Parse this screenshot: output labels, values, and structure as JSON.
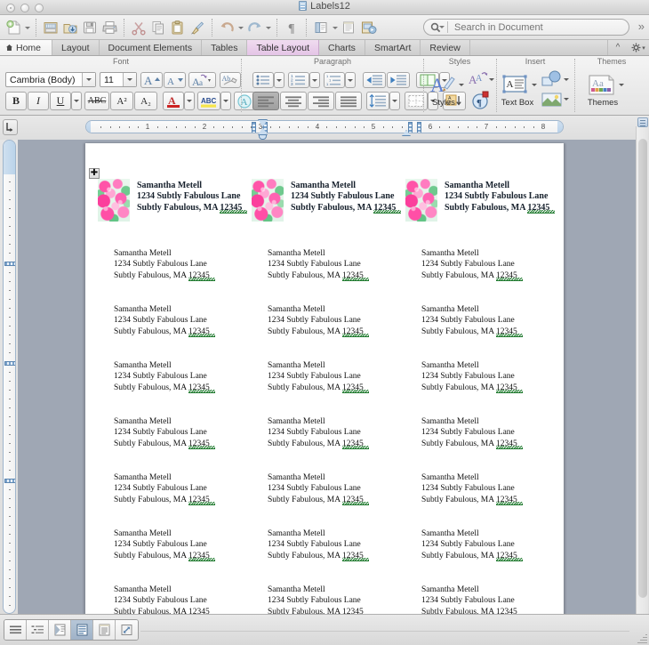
{
  "window": {
    "title": "Labels12",
    "doc_icon": "document-icon",
    "traffic_lights": [
      "close-button",
      "minimize-button",
      "zoom-button"
    ]
  },
  "toolbar": {
    "items": [
      {
        "name": "new-document-button",
        "icon": "new-document-icon",
        "caret": true
      },
      {
        "sep": true
      },
      {
        "name": "open-button",
        "icon": "open-folder-icon",
        "caret": false
      },
      {
        "name": "save-as-download-button",
        "icon": "download-arrow-icon",
        "caret": false
      },
      {
        "name": "save-button",
        "icon": "floppy-disk-icon",
        "caret": false
      },
      {
        "name": "print-button",
        "icon": "printer-icon",
        "caret": false
      },
      {
        "sep": true
      },
      {
        "name": "cut-button",
        "icon": "scissors-icon",
        "caret": false
      },
      {
        "name": "copy-button",
        "icon": "copy-pages-icon",
        "caret": false
      },
      {
        "name": "paste-button",
        "icon": "clipboard-icon",
        "caret": false
      },
      {
        "name": "format-painter-button",
        "icon": "paintbrush-icon",
        "caret": false
      },
      {
        "sep": true
      },
      {
        "name": "undo-button",
        "icon": "undo-arrow-icon",
        "caret": true
      },
      {
        "name": "redo-button",
        "icon": "redo-arrow-icon",
        "caret": true
      },
      {
        "sep": true
      },
      {
        "name": "show-formatting-marks-button",
        "icon": "pilcrow-icon",
        "caret": false
      },
      {
        "sep": true
      },
      {
        "name": "sidebar-toggle-button",
        "icon": "sidebar-panel-icon",
        "caret": true
      },
      {
        "name": "notebook-layout-button",
        "icon": "document-lines-icon",
        "caret": false
      },
      {
        "name": "media-browser-button",
        "icon": "media-browser-icon",
        "caret": false
      }
    ],
    "search": {
      "placeholder": "Search in Document",
      "value": "",
      "icon": "search-magnifier-icon"
    },
    "overflow_label": "»"
  },
  "ribbon_tabs": {
    "active": "Table Layout",
    "items": [
      {
        "label": "Home",
        "icon": "home-icon",
        "active": false,
        "home": true
      },
      {
        "label": "Layout",
        "active": false
      },
      {
        "label": "Document Elements",
        "active": false
      },
      {
        "label": "Tables",
        "active": false
      },
      {
        "label": "Table Layout",
        "active": true
      },
      {
        "label": "Charts",
        "active": false
      },
      {
        "label": "SmartArt",
        "active": false
      },
      {
        "label": "Review",
        "active": false
      }
    ],
    "collapse_icon": "chevron-up-icon",
    "settings_icon": "gear-icon"
  },
  "ribbon": {
    "groups": [
      {
        "label": "Font"
      },
      {
        "label": "Paragraph"
      },
      {
        "label": "Styles"
      },
      {
        "label": "Insert"
      },
      {
        "label": "Themes"
      }
    ],
    "font": {
      "font_name": "Cambria (Body)",
      "font_size": "11",
      "grow_font": "grow-font-icon",
      "shrink_font": "shrink-font-icon",
      "change_case": "change-case-icon",
      "clear_formatting": "clear-formatting-icon",
      "bold": "B",
      "italic": "I",
      "underline": "U",
      "strikethrough": "ABC",
      "superscript": "A²",
      "subscript": "A₂",
      "font_color": "font-color-icon",
      "highlight": "highlight-icon",
      "text_effects": "text-effects-icon"
    },
    "paragraph": {
      "bullets": "bulleted-list-icon",
      "numbering": "numbered-list-icon",
      "multilevel": "multilevel-list-icon",
      "decrease_indent": "decrease-indent-icon",
      "increase_indent": "increase-indent-icon",
      "columns": "columns-icon",
      "align_left": "align-left-icon",
      "align_center": "align-center-icon",
      "align_right": "align-right-icon",
      "justify": "justify-icon",
      "line_spacing": "line-spacing-icon",
      "borders": "borders-icon",
      "sort": "sort-az-icon"
    },
    "styles": {
      "styles_label": "Styles",
      "styles_icon": "styles-pen-icon",
      "quick_styles_icon": "quick-styles-icon",
      "toolbox_icon": "toolbox-icon"
    },
    "insert": {
      "text_box_label": "Text Box",
      "text_box_icon": "text-box-icon",
      "shapes_icon": "shapes-icon",
      "picture_icon": "picture-icon"
    },
    "themes": {
      "themes_label": "Themes",
      "themes_icon": "themes-icon"
    }
  },
  "ruler": {
    "tab_selector_icon": "tab-stop-selector-icon",
    "horizontal_numbers": [
      "1",
      "2",
      "3",
      "4",
      "5",
      "6",
      "7",
      "8"
    ],
    "unit": "inches"
  },
  "document": {
    "page_label": "label-sheet-page",
    "table_move_handle": "✚",
    "rows": [
      {
        "has_image": true,
        "cells": [
          {
            "image": "floral-roses-thumbnail",
            "lines": [
              "Samantha Metell",
              "1234 Subtly Fabulous Lane",
              "Subtly Fabulous, MA "
            ],
            "zip": "12345"
          },
          {
            "image": "floral-roses-thumbnail",
            "lines": [
              "Samantha Metell",
              "1234 Subtly Fabulous Lane",
              "Subtly Fabulous, MA "
            ],
            "zip": "12345"
          },
          {
            "image": "floral-roses-thumbnail",
            "lines": [
              "Samantha Metell",
              "1234 Subtly Fabulous Lane",
              "Subtly Fabulous, MA "
            ],
            "zip": "12345"
          }
        ]
      },
      {
        "has_image": false,
        "cells": [
          {
            "lines": [
              "Samantha Metell",
              "1234 Subtly Fabulous Lane",
              "Subtly Fabulous, MA "
            ],
            "zip": "12345"
          },
          {
            "lines": [
              "Samantha Metell",
              "1234 Subtly Fabulous Lane",
              "Subtly Fabulous, MA "
            ],
            "zip": "12345"
          },
          {
            "lines": [
              "Samantha Metell",
              "1234 Subtly Fabulous Lane",
              "Subtly Fabulous, MA "
            ],
            "zip": "12345"
          }
        ]
      },
      {
        "has_image": false,
        "cells": [
          {
            "lines": [
              "Samantha Metell",
              "1234 Subtly Fabulous Lane",
              "Subtly Fabulous, MA "
            ],
            "zip": "12345"
          },
          {
            "lines": [
              "Samantha Metell",
              "1234 Subtly Fabulous Lane",
              "Subtly Fabulous, MA "
            ],
            "zip": "12345"
          },
          {
            "lines": [
              "Samantha Metell",
              "1234 Subtly Fabulous Lane",
              "Subtly Fabulous, MA "
            ],
            "zip": "12345"
          }
        ]
      },
      {
        "has_image": false,
        "cells": [
          {
            "lines": [
              "Samantha Metell",
              "1234 Subtly Fabulous Lane",
              "Subtly Fabulous, MA "
            ],
            "zip": "12345"
          },
          {
            "lines": [
              "Samantha Metell",
              "1234 Subtly Fabulous Lane",
              "Subtly Fabulous, MA "
            ],
            "zip": "12345"
          },
          {
            "lines": [
              "Samantha Metell",
              "1234 Subtly Fabulous Lane",
              "Subtly Fabulous, MA "
            ],
            "zip": "12345"
          }
        ]
      },
      {
        "has_image": false,
        "cells": [
          {
            "lines": [
              "Samantha Metell",
              "1234 Subtly Fabulous Lane",
              "Subtly Fabulous, MA "
            ],
            "zip": "12345"
          },
          {
            "lines": [
              "Samantha Metell",
              "1234 Subtly Fabulous Lane",
              "Subtly Fabulous, MA "
            ],
            "zip": "12345"
          },
          {
            "lines": [
              "Samantha Metell",
              "1234 Subtly Fabulous Lane",
              "Subtly Fabulous, MA "
            ],
            "zip": "12345"
          }
        ]
      },
      {
        "has_image": false,
        "cells": [
          {
            "lines": [
              "Samantha Metell",
              "1234 Subtly Fabulous Lane",
              "Subtly Fabulous, MA "
            ],
            "zip": "12345"
          },
          {
            "lines": [
              "Samantha Metell",
              "1234 Subtly Fabulous Lane",
              "Subtly Fabulous, MA "
            ],
            "zip": "12345"
          },
          {
            "lines": [
              "Samantha Metell",
              "1234 Subtly Fabulous Lane",
              "Subtly Fabulous, MA "
            ],
            "zip": "12345"
          }
        ]
      },
      {
        "has_image": false,
        "cells": [
          {
            "lines": [
              "Samantha Metell",
              "1234 Subtly Fabulous Lane",
              "Subtly Fabulous, MA "
            ],
            "zip": "12345"
          },
          {
            "lines": [
              "Samantha Metell",
              "1234 Subtly Fabulous Lane",
              "Subtly Fabulous, MA "
            ],
            "zip": "12345"
          },
          {
            "lines": [
              "Samantha Metell",
              "1234 Subtly Fabulous Lane",
              "Subtly Fabulous, MA "
            ],
            "zip": "12345"
          }
        ]
      },
      {
        "has_image": false,
        "cells": [
          {
            "lines": [
              "Samantha Metell",
              "1234 Subtly Fabulous Lane",
              "Subtly Fabulous, MA "
            ],
            "zip": "12345"
          },
          {
            "lines": [
              "Samantha Metell",
              "1234 Subtly Fabulous Lane",
              "Subtly Fabulous, MA "
            ],
            "zip": "12345"
          },
          {
            "lines": [
              "Samantha Metell",
              "1234 Subtly Fabulous Lane",
              "Subtly Fabulous, MA "
            ],
            "zip": "12345"
          }
        ]
      }
    ]
  },
  "status_bar": {
    "view_buttons": [
      {
        "name": "draft-view-button",
        "icon": "draft-view-icon",
        "active": false
      },
      {
        "name": "outline-view-button",
        "icon": "outline-view-icon",
        "active": false
      },
      {
        "name": "publishing-layout-button",
        "icon": "publishing-layout-icon",
        "active": false
      },
      {
        "name": "print-layout-button",
        "icon": "print-layout-icon",
        "active": true
      },
      {
        "name": "notebook-layout-button",
        "icon": "notebook-layout-icon",
        "active": false
      },
      {
        "name": "full-screen-button",
        "icon": "full-screen-icon",
        "active": false
      }
    ]
  },
  "colors": {
    "accent_tab": "#e4c4e6",
    "spelling_underline": "#1f7a2e",
    "page_background": "#ffffff",
    "desk_background": "#9fa7b4",
    "chrome": "#e3e3e3"
  }
}
